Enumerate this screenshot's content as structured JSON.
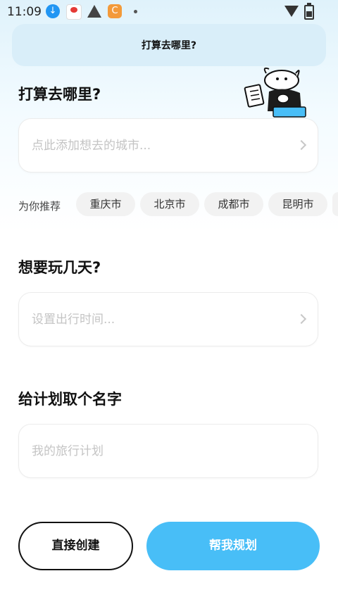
{
  "status_bar": {
    "time": "11:09",
    "icons": [
      "download-icon",
      "app-notification-icon",
      "warning-icon",
      "c-app-icon",
      "dot-icon",
      "wifi-icon",
      "battery-icon"
    ]
  },
  "banner": {
    "title": "打算去哪里?"
  },
  "destination": {
    "title": "打算去哪里?",
    "placeholder": "点此添加想去的城市...",
    "recommend_label": "为你推荐",
    "chips": [
      "重庆市",
      "北京市",
      "成都市",
      "昆明市"
    ]
  },
  "duration": {
    "title": "想要玩几天?",
    "placeholder": "设置出行时间..."
  },
  "plan_name": {
    "title": "给计划取个名字",
    "placeholder": "我的旅行计划"
  },
  "actions": {
    "direct_create": "直接创建",
    "help_plan": "帮我规划"
  },
  "colors": {
    "accent": "#48bef7",
    "banner_bg": "#d9eef9",
    "chip_bg": "#f2f2f2",
    "placeholder": "#c4c4c4"
  }
}
